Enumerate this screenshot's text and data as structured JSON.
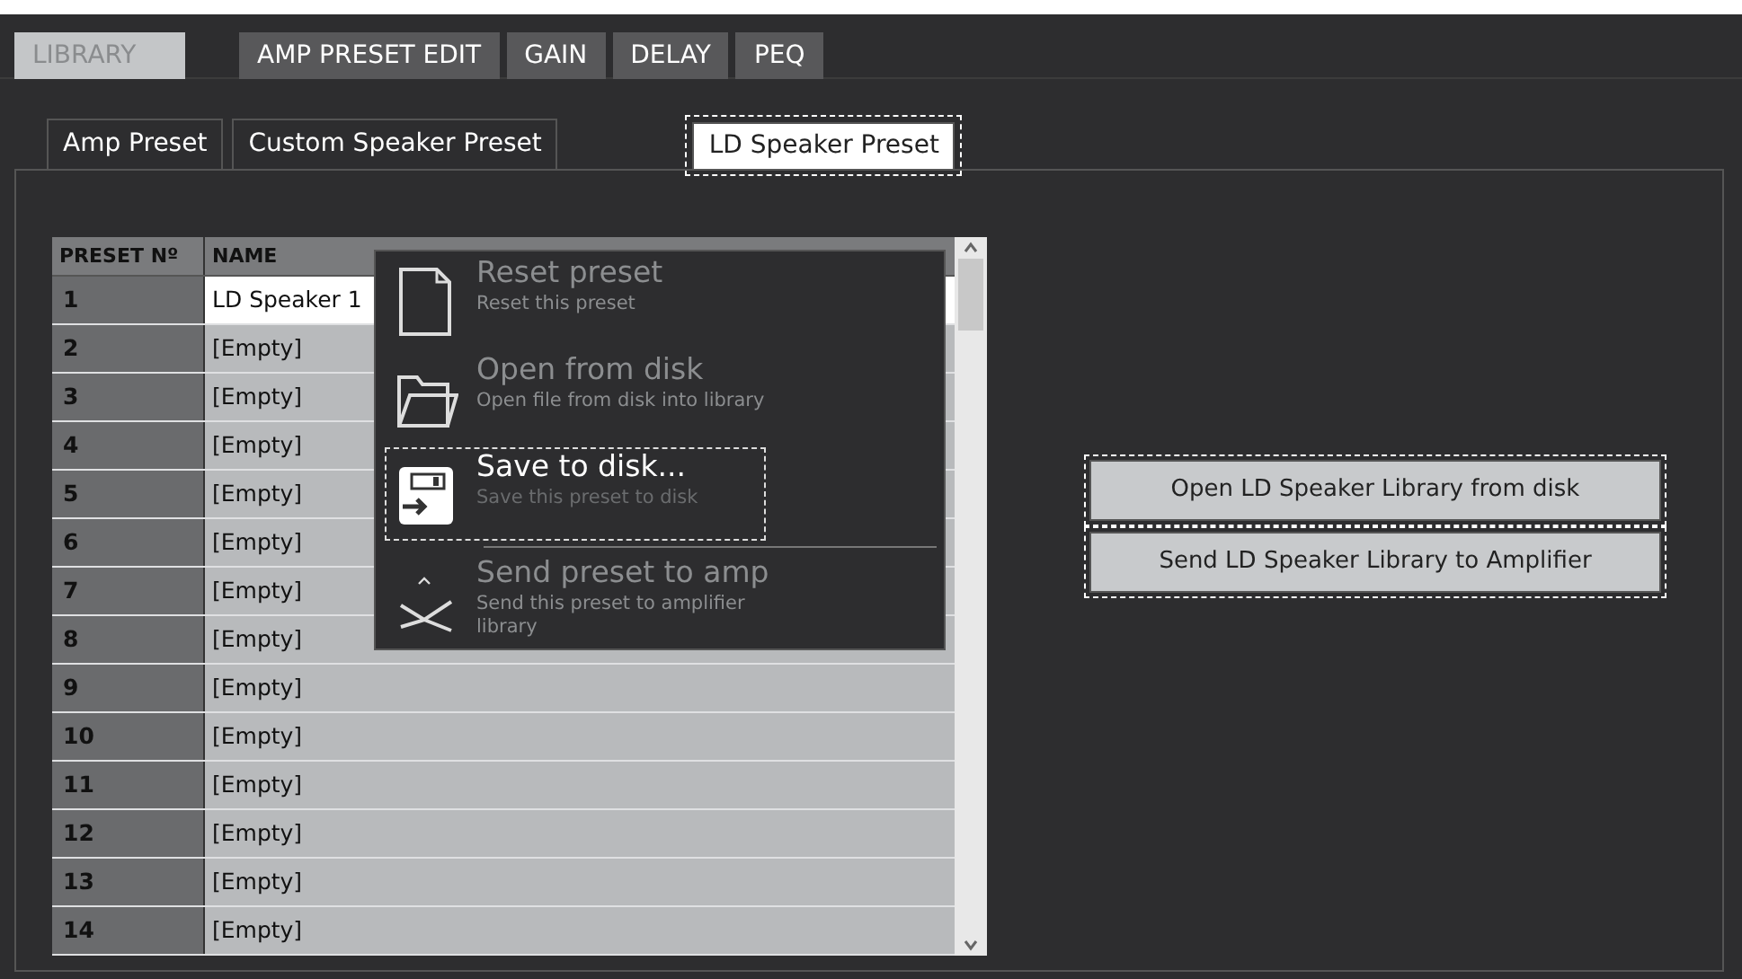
{
  "main_tabs": [
    {
      "label": "LIBRARY",
      "selected": true
    },
    {
      "label": "AMP PRESET EDIT",
      "selected": false
    },
    {
      "label": "GAIN",
      "selected": false
    },
    {
      "label": "DELAY",
      "selected": false
    },
    {
      "label": "PEQ",
      "selected": false
    }
  ],
  "sub_tabs": [
    {
      "label": "Amp Preset",
      "selected": false
    },
    {
      "label": "Custom Speaker Preset",
      "selected": false
    },
    {
      "label": "LD Speaker Preset",
      "selected": true
    }
  ],
  "table": {
    "columns": [
      "PRESET Nº",
      "NAME"
    ],
    "rows": [
      {
        "number": "1",
        "name": "LD Speaker 1",
        "selected": true
      },
      {
        "number": "2",
        "name": "[Empty]",
        "selected": false
      },
      {
        "number": "3",
        "name": "[Empty]",
        "selected": false
      },
      {
        "number": "4",
        "name": "[Empty]",
        "selected": false
      },
      {
        "number": "5",
        "name": "[Empty]",
        "selected": false
      },
      {
        "number": "6",
        "name": "[Empty]",
        "selected": false
      },
      {
        "number": "7",
        "name": "[Empty]",
        "selected": false
      },
      {
        "number": "8",
        "name": "[Empty]",
        "selected": false
      },
      {
        "number": "9",
        "name": "[Empty]",
        "selected": false
      },
      {
        "number": "10",
        "name": "[Empty]",
        "selected": false
      },
      {
        "number": "11",
        "name": "[Empty]",
        "selected": false
      },
      {
        "number": "12",
        "name": "[Empty]",
        "selected": false
      },
      {
        "number": "13",
        "name": "[Empty]",
        "selected": false
      },
      {
        "number": "14",
        "name": "[Empty]",
        "selected": false
      }
    ]
  },
  "context_menu": {
    "items": [
      {
        "kind": "document",
        "label": "Reset preset",
        "description": "Reset this preset",
        "disabled": true,
        "selected": false,
        "separator_before": false
      },
      {
        "kind": "folder",
        "label": "Open from disk",
        "description": "Open file from disk into library",
        "disabled": true,
        "selected": false,
        "separator_before": false
      },
      {
        "kind": "save",
        "label": "Save to disk...",
        "description": "Save this preset to disk",
        "disabled": false,
        "selected": true,
        "separator_before": false
      },
      {
        "kind": "send",
        "label": "Send preset to amp",
        "description": "Send this preset to amplifier library",
        "disabled": true,
        "selected": false,
        "separator_before": true
      }
    ]
  },
  "buttons": [
    "Open LD Speaker Library from disk",
    "Send LD Speaker Library to Amplifier"
  ]
}
